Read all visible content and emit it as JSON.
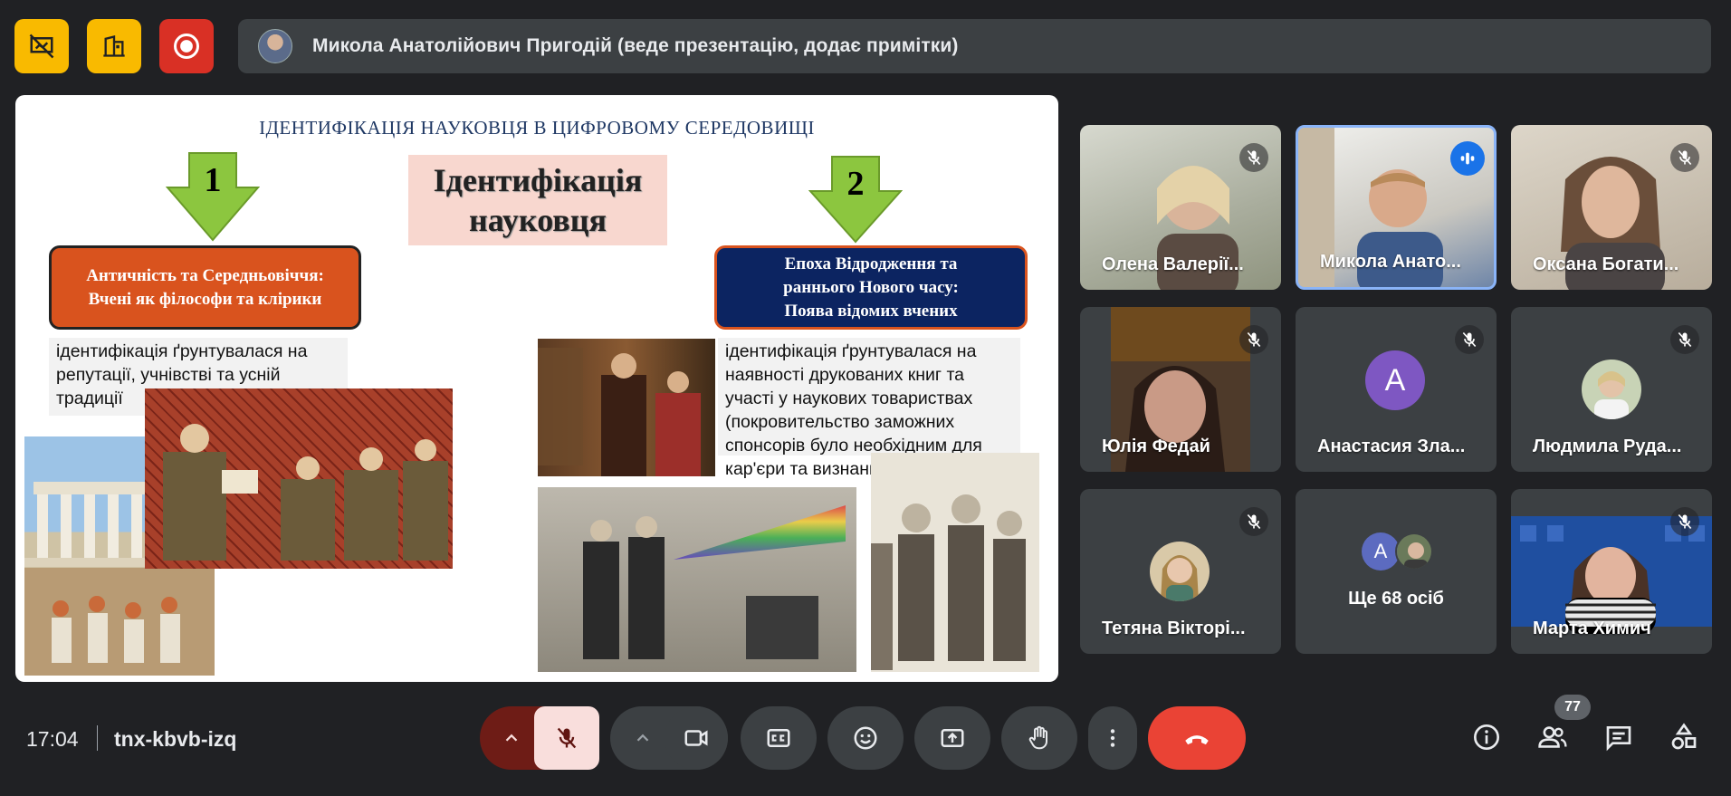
{
  "presenter_bar": {
    "text": "Микола Анатолійович Пригодій (веде презентацію, додає примітки)"
  },
  "slide": {
    "title": "ІДЕНТИФІКАЦІЯ НАУКОВЦЯ В ЦИФРОВОМУ СЕРЕДОВИЩІ",
    "arrow1": "1",
    "arrow2": "2",
    "center_line1": "Ідентифікація",
    "center_line2": "науковця",
    "left_box_line1": "Античність та Середньовіччя:",
    "left_box_line2": "Вчені як філософи та клірики",
    "right_box_line1": "Епоха Відродження та",
    "right_box_line2": "раннього Нового часу:",
    "right_box_line3": "Поява відомих вчених",
    "left_desc": "ідентифікація ґрунтувалася на репутації, учнівстві та усній традиції",
    "right_desc": "ідентифікація ґрунтувалася на наявності друкованих книг та участі у наукових товариствах (покровительство заможних спонсорів було необхідним для кар'єри та визнання вченого)"
  },
  "participants": [
    {
      "name": "Олена Валерії...",
      "muted": true
    },
    {
      "name": "Микола Анато...",
      "speaking": true
    },
    {
      "name": "Оксана Богати...",
      "muted": true
    },
    {
      "name": "Юлія Федай",
      "muted": true
    },
    {
      "name": "Анастасия Зла...",
      "muted": true,
      "initial": "А"
    },
    {
      "name": "Людмила Руда...",
      "muted": true
    },
    {
      "name": "Тетяна Вікторі...",
      "muted": true
    },
    {
      "name": "Марта Химич",
      "muted": true
    }
  ],
  "more": {
    "initial": "А",
    "label": "Ще 68 осіб"
  },
  "bottom": {
    "time": "17:04",
    "meeting_code": "tnx-kbvb-izq",
    "participants_count": "77"
  },
  "colors": {
    "background": "#202124",
    "surface": "#3c4043",
    "yellow": "#f9ba00",
    "red": "#d93025",
    "hangup": "#ea4335",
    "mic_off_bg": "#f9dedc",
    "active_border": "#8ab4f8"
  },
  "icons": {
    "top_left": [
      "presentation-off-icon",
      "building-icon",
      "record-icon"
    ],
    "controls": [
      "chevron-up-icon",
      "mic-off-icon",
      "chevron-up-icon",
      "camera-icon",
      "captions-icon",
      "emoji-icon",
      "present-icon",
      "raise-hand-icon",
      "more-vert-icon",
      "hangup-icon"
    ],
    "right": [
      "info-icon",
      "people-icon",
      "chat-icon",
      "activities-icon"
    ]
  }
}
